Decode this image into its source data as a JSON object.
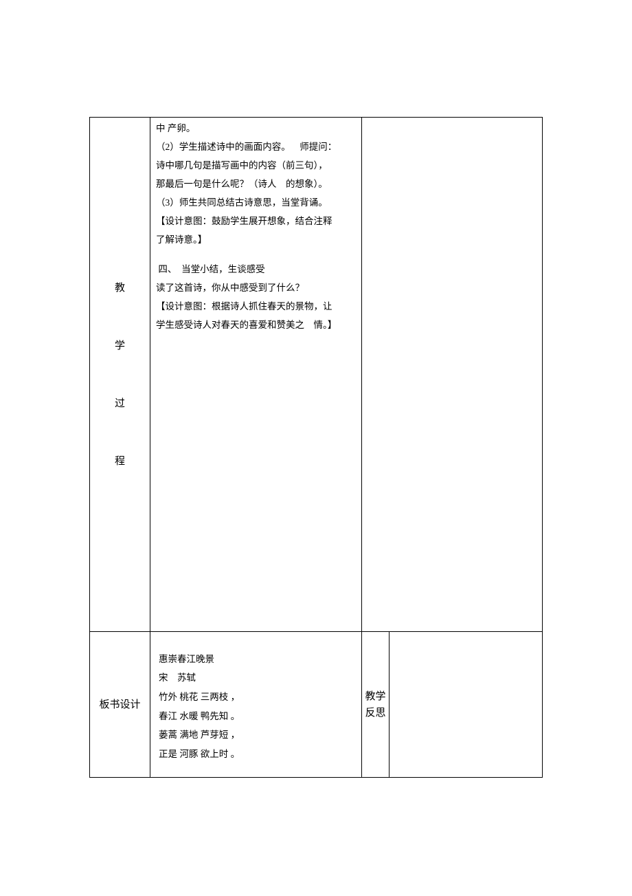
{
  "process": {
    "label_char1": "教",
    "label_char2": "学",
    "label_char3": "过",
    "label_char4": "程",
    "lines": {
      "l1": "中 产卵。",
      "l2a": "（2）学生描述诗中的画面内容。",
      "l2b": "师提问：",
      "l3": "诗中哪几句是描写画中的内容（前三句），",
      "l4a": "那最后一句是什么呢？（诗人",
      "l4b": "的想象）。",
      "l5": "（3）师生共同总结古诗意思，当堂背诵。",
      "l6": "【设计意图：鼓励学生展开想象，结合注释",
      "l7": "了解诗意。】",
      "l8a": "四、",
      "l8b": "当堂小结，生谈感受",
      "l9": "读了这首诗，你从中感受到了什么？",
      "l10": "【设计意图：根据诗人抓住春天的景物，让",
      "l11a": "学生感受诗人对春天的喜爱和赞美之",
      "l11b": "情。】"
    }
  },
  "board": {
    "label": "板书设计",
    "lines": {
      "b1": "惠崇春江晚景",
      "b2a": "宋",
      "b2b": "苏轼",
      "b3": "竹外 桃花 三两枝 ，",
      "b4": "春江 水暖 鸭先知 。",
      "b5": "蒌蒿 满地 芦芽短 ，",
      "b6": "正是 河豚 欲上时 。"
    }
  },
  "reflection": {
    "label_line1": "教学",
    "label_line2": "反思"
  }
}
